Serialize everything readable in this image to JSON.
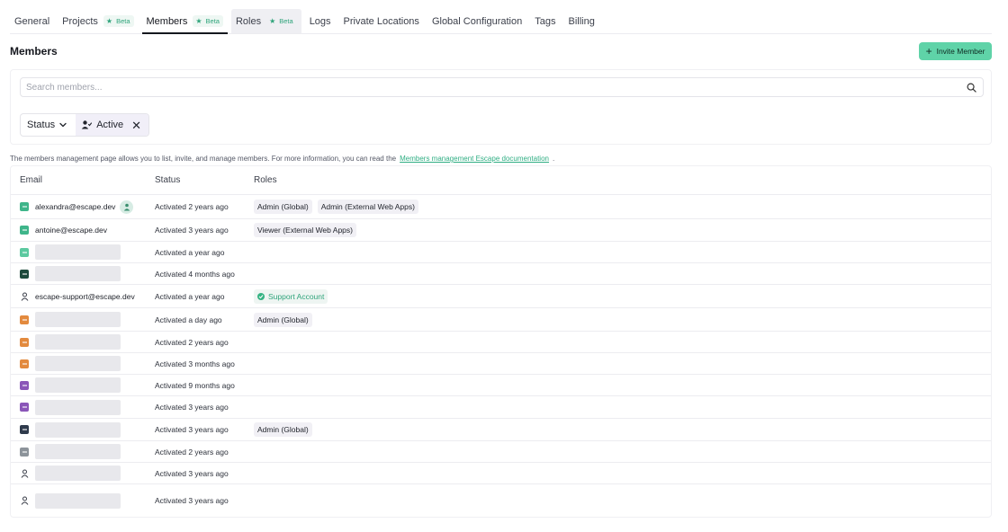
{
  "tabs": [
    {
      "label": "General",
      "beta": ""
    },
    {
      "label": "Projects",
      "beta": "Beta"
    },
    {
      "label": "Members",
      "beta": "Beta"
    },
    {
      "label": "Roles",
      "beta": "Beta"
    },
    {
      "label": "Logs",
      "beta": ""
    },
    {
      "label": "Private Locations",
      "beta": ""
    },
    {
      "label": "Global Configuration",
      "beta": ""
    },
    {
      "label": "Tags",
      "beta": ""
    },
    {
      "label": "Billing",
      "beta": ""
    }
  ],
  "page": {
    "title": "Members",
    "invite_label": "Invite Member"
  },
  "search": {
    "placeholder": "Search members..."
  },
  "filter": {
    "status_label": "Status",
    "active_label": "Active"
  },
  "help": {
    "text": "The members management page allows you to list, invite, and manage members. For more information, you can read the",
    "link": "Members management Escape documentation",
    "suffix": "."
  },
  "table": {
    "headers": {
      "email": "Email",
      "status": "Status",
      "roles": "Roles"
    },
    "rows": [
      {
        "email": "alexandra@escape.dev",
        "status": "Activated 2 years ago",
        "roles": [
          {
            "bold": "Admin (Global)",
            "rest": ""
          },
          {
            "bold": "",
            "rest": "Admin (External Web Apps)"
          }
        ],
        "avatar_color": "#3fb58a",
        "me": true
      },
      {
        "email": "antoine@escape.dev",
        "status": "Activated 3 years ago",
        "roles": [
          {
            "bold": "",
            "rest": "Viewer (External Web Apps)"
          }
        ],
        "avatar_color": "#3fb58a"
      },
      {
        "email": "",
        "status": "Activated a year ago",
        "roles": [],
        "avatar_color": "#5cc9a0"
      },
      {
        "email": "",
        "status": "Activated 4 months ago",
        "roles": [],
        "avatar_color": "#1d4a3c"
      },
      {
        "email": "escape-support@escape.dev",
        "status": "Activated a year ago",
        "roles": [
          {
            "support": "Support Account"
          }
        ],
        "avatar_color": "user"
      },
      {
        "email": "",
        "status": "Activated a day ago",
        "roles": [
          {
            "bold": "Admin (Global)",
            "rest": ""
          }
        ],
        "avatar_color": "#e38a3e"
      },
      {
        "email": "",
        "status": "Activated 2 years ago",
        "roles": [],
        "avatar_color": "#e38a3e"
      },
      {
        "email": "",
        "status": "Activated 3 months ago",
        "roles": [],
        "avatar_color": "#e38a3e"
      },
      {
        "email": "",
        "status": "Activated 9 months ago",
        "roles": [],
        "avatar_color": "#8a56b8"
      },
      {
        "email": "",
        "status": "Activated 3 years ago",
        "roles": [],
        "avatar_color": "#8a56b8"
      },
      {
        "email": "",
        "status": "Activated 3 years ago",
        "roles": [
          {
            "bold": "Admin (Global)",
            "rest": ""
          }
        ],
        "avatar_color": "#2f3b4c"
      },
      {
        "email": "",
        "status": "Activated 2 years ago",
        "roles": [],
        "avatar_color": "#8c939a"
      },
      {
        "email": "",
        "status": "Activated 3 years ago",
        "roles": [],
        "avatar_color": "user"
      },
      {
        "email": "",
        "status": "Activated 3 years ago",
        "roles": [],
        "avatar_color": "user"
      }
    ]
  },
  "colors": {
    "accent": "#5fd3a8",
    "link": "#2fae83",
    "beta": "#2fa47b"
  },
  "icons": {
    "search": "search-icon",
    "chevron": "chevron-down-icon",
    "user_check": "user-check-icon",
    "close": "close-icon",
    "plus": "plus-icon",
    "user": "user-icon"
  }
}
